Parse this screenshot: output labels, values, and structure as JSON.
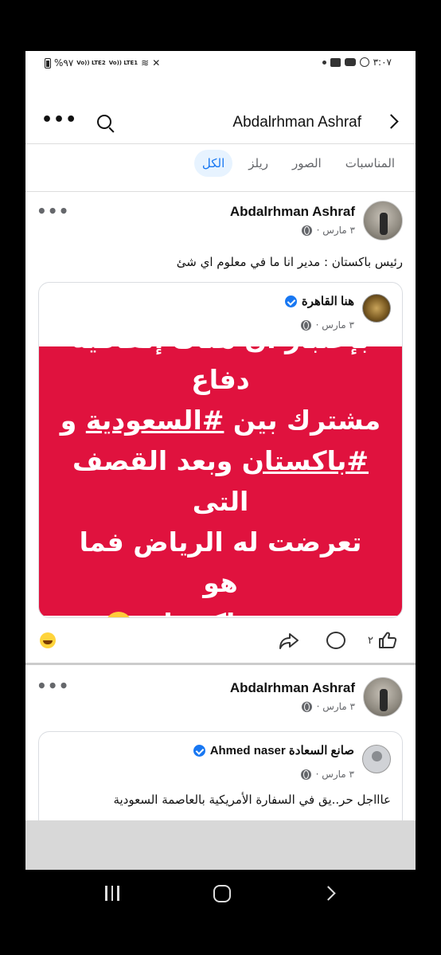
{
  "status_bar": {
    "time": "٣:٠٧",
    "battery": "%٩٧",
    "sim1": "Vo)) LTE2",
    "sim2": "Vo)) LTE1"
  },
  "header": {
    "title": "Abdalrhman Ashraf"
  },
  "tabs": [
    {
      "label": "الكل",
      "active": true
    },
    {
      "label": "ريلز",
      "active": false
    },
    {
      "label": "الصور",
      "active": false
    },
    {
      "label": "المناسبات",
      "active": false
    }
  ],
  "posts": [
    {
      "author": "Abdalrhman Ashraf",
      "date": "٣ مارس ·",
      "text": "رئيس باكستان : مدير انا ما في معلوم اي شئ",
      "shared": {
        "page_name": "هنا القاهرة",
        "date": "٣ مارس ·",
        "line1": "بإعتبار أن هناك إتفاقية دفاع",
        "line2_pre": "مشترك بين ",
        "line2_tag": "#السعودية",
        "line2_post": " و",
        "line3_tag": "#باكستان",
        "line3_post": " وبعد القصف التى",
        "line4": "تعرضت له الرياض فما هو",
        "line5": "موقف باكستان"
      },
      "likes": "٢"
    },
    {
      "author": "Abdalrhman Ashraf",
      "date": "٣ مارس ·",
      "shared": {
        "page_name": "صانع السعادة Ahmed naser",
        "date": "٣ مارس ·",
        "text": "عاااجل حر..يق في السفارة الأمريكية بالعاصمة السعودية"
      }
    }
  ],
  "colors": {
    "accent": "#1877f2",
    "red_banner": "#e0123e"
  }
}
